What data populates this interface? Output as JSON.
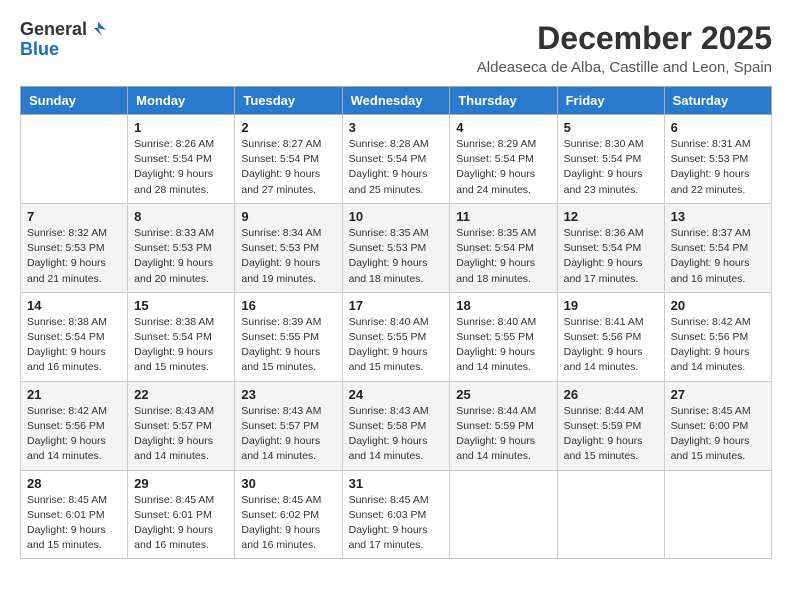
{
  "header": {
    "logo_general": "General",
    "logo_blue": "Blue",
    "month_title": "December 2025",
    "location": "Aldeaseca de Alba, Castille and Leon, Spain"
  },
  "days_of_week": [
    "Sunday",
    "Monday",
    "Tuesday",
    "Wednesday",
    "Thursday",
    "Friday",
    "Saturday"
  ],
  "weeks": [
    [
      {
        "day": "",
        "info": ""
      },
      {
        "day": "1",
        "info": "Sunrise: 8:26 AM\nSunset: 5:54 PM\nDaylight: 9 hours\nand 28 minutes."
      },
      {
        "day": "2",
        "info": "Sunrise: 8:27 AM\nSunset: 5:54 PM\nDaylight: 9 hours\nand 27 minutes."
      },
      {
        "day": "3",
        "info": "Sunrise: 8:28 AM\nSunset: 5:54 PM\nDaylight: 9 hours\nand 25 minutes."
      },
      {
        "day": "4",
        "info": "Sunrise: 8:29 AM\nSunset: 5:54 PM\nDaylight: 9 hours\nand 24 minutes."
      },
      {
        "day": "5",
        "info": "Sunrise: 8:30 AM\nSunset: 5:54 PM\nDaylight: 9 hours\nand 23 minutes."
      },
      {
        "day": "6",
        "info": "Sunrise: 8:31 AM\nSunset: 5:53 PM\nDaylight: 9 hours\nand 22 minutes."
      }
    ],
    [
      {
        "day": "7",
        "info": "Sunrise: 8:32 AM\nSunset: 5:53 PM\nDaylight: 9 hours\nand 21 minutes."
      },
      {
        "day": "8",
        "info": "Sunrise: 8:33 AM\nSunset: 5:53 PM\nDaylight: 9 hours\nand 20 minutes."
      },
      {
        "day": "9",
        "info": "Sunrise: 8:34 AM\nSunset: 5:53 PM\nDaylight: 9 hours\nand 19 minutes."
      },
      {
        "day": "10",
        "info": "Sunrise: 8:35 AM\nSunset: 5:53 PM\nDaylight: 9 hours\nand 18 minutes."
      },
      {
        "day": "11",
        "info": "Sunrise: 8:35 AM\nSunset: 5:54 PM\nDaylight: 9 hours\nand 18 minutes."
      },
      {
        "day": "12",
        "info": "Sunrise: 8:36 AM\nSunset: 5:54 PM\nDaylight: 9 hours\nand 17 minutes."
      },
      {
        "day": "13",
        "info": "Sunrise: 8:37 AM\nSunset: 5:54 PM\nDaylight: 9 hours\nand 16 minutes."
      }
    ],
    [
      {
        "day": "14",
        "info": "Sunrise: 8:38 AM\nSunset: 5:54 PM\nDaylight: 9 hours\nand 16 minutes."
      },
      {
        "day": "15",
        "info": "Sunrise: 8:38 AM\nSunset: 5:54 PM\nDaylight: 9 hours\nand 15 minutes."
      },
      {
        "day": "16",
        "info": "Sunrise: 8:39 AM\nSunset: 5:55 PM\nDaylight: 9 hours\nand 15 minutes."
      },
      {
        "day": "17",
        "info": "Sunrise: 8:40 AM\nSunset: 5:55 PM\nDaylight: 9 hours\nand 15 minutes."
      },
      {
        "day": "18",
        "info": "Sunrise: 8:40 AM\nSunset: 5:55 PM\nDaylight: 9 hours\nand 14 minutes."
      },
      {
        "day": "19",
        "info": "Sunrise: 8:41 AM\nSunset: 5:56 PM\nDaylight: 9 hours\nand 14 minutes."
      },
      {
        "day": "20",
        "info": "Sunrise: 8:42 AM\nSunset: 5:56 PM\nDaylight: 9 hours\nand 14 minutes."
      }
    ],
    [
      {
        "day": "21",
        "info": "Sunrise: 8:42 AM\nSunset: 5:56 PM\nDaylight: 9 hours\nand 14 minutes."
      },
      {
        "day": "22",
        "info": "Sunrise: 8:43 AM\nSunset: 5:57 PM\nDaylight: 9 hours\nand 14 minutes."
      },
      {
        "day": "23",
        "info": "Sunrise: 8:43 AM\nSunset: 5:57 PM\nDaylight: 9 hours\nand 14 minutes."
      },
      {
        "day": "24",
        "info": "Sunrise: 8:43 AM\nSunset: 5:58 PM\nDaylight: 9 hours\nand 14 minutes."
      },
      {
        "day": "25",
        "info": "Sunrise: 8:44 AM\nSunset: 5:59 PM\nDaylight: 9 hours\nand 14 minutes."
      },
      {
        "day": "26",
        "info": "Sunrise: 8:44 AM\nSunset: 5:59 PM\nDaylight: 9 hours\nand 15 minutes."
      },
      {
        "day": "27",
        "info": "Sunrise: 8:45 AM\nSunset: 6:00 PM\nDaylight: 9 hours\nand 15 minutes."
      }
    ],
    [
      {
        "day": "28",
        "info": "Sunrise: 8:45 AM\nSunset: 6:01 PM\nDaylight: 9 hours\nand 15 minutes."
      },
      {
        "day": "29",
        "info": "Sunrise: 8:45 AM\nSunset: 6:01 PM\nDaylight: 9 hours\nand 16 minutes."
      },
      {
        "day": "30",
        "info": "Sunrise: 8:45 AM\nSunset: 6:02 PM\nDaylight: 9 hours\nand 16 minutes."
      },
      {
        "day": "31",
        "info": "Sunrise: 8:45 AM\nSunset: 6:03 PM\nDaylight: 9 hours\nand 17 minutes."
      },
      {
        "day": "",
        "info": ""
      },
      {
        "day": "",
        "info": ""
      },
      {
        "day": "",
        "info": ""
      }
    ]
  ]
}
